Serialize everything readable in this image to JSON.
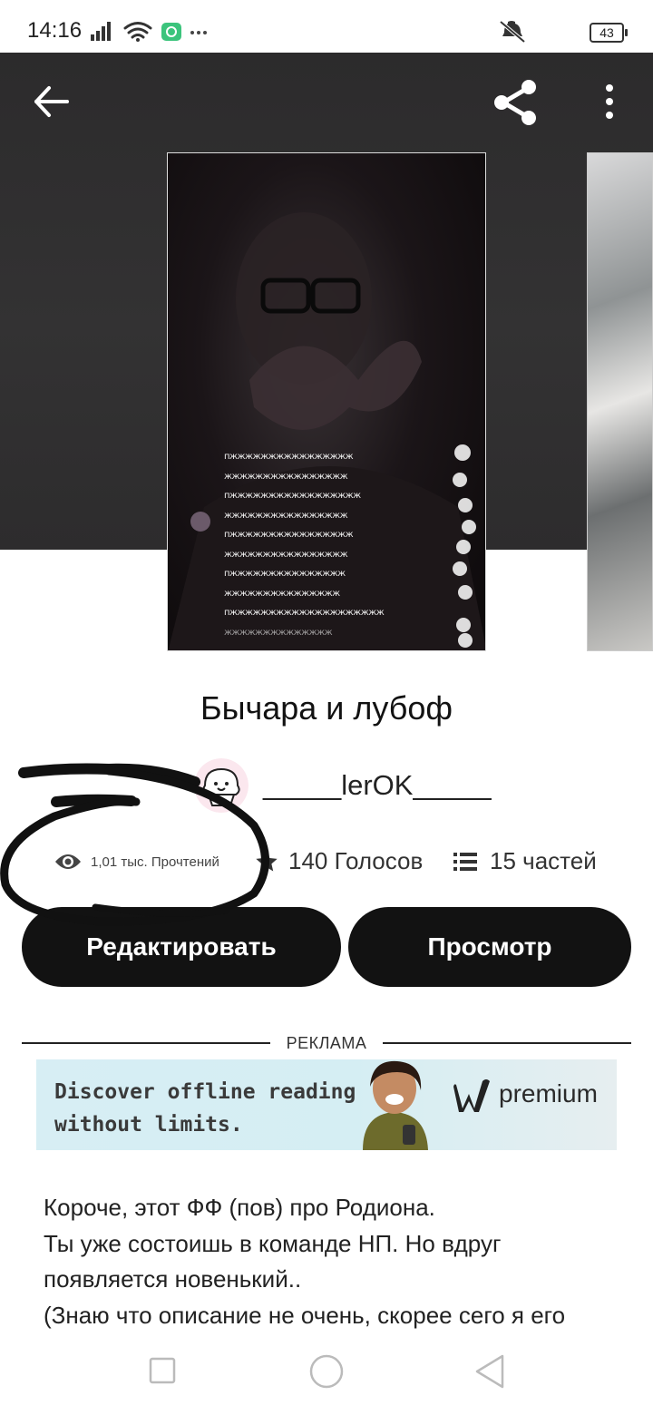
{
  "status_bar": {
    "time": "14:16",
    "battery": "43"
  },
  "toolbar": {
    "back_icon": "arrow-left-icon",
    "share_icon": "share-icon",
    "more_icon": "more-vertical-icon"
  },
  "story": {
    "title": "Бычара и лубоф",
    "author": "_____lerOK_____",
    "reads": "1,01 тыс. Прочтений",
    "votes": "140 Голосов",
    "parts": "15 частей",
    "cover_text": [
      "пжжжжжжжжжжжжжжжж",
      "жжжжжжжжжжжжжжжж",
      "пжжжжжжжжжжжжжжжжж",
      "жжжжжжжжжжжжжжжж",
      "пжжжжжжжжжжжжжжжж",
      "жжжжжжжжжжжжжжжж",
      "пжжжжжжжжжжжжжжж",
      "жжжжжжжжжжжжжжж",
      "пжжжжжжжжжжжжжжжжжжжж",
      "жжжжжжжжжжжжжж"
    ]
  },
  "actions": {
    "edit_label": "Редактировать",
    "view_label": "Просмотр"
  },
  "ad": {
    "label": "РЕКЛАМА",
    "line1": "Discover offline reading",
    "line2": "without limits.",
    "brand": "premium"
  },
  "description": {
    "lines": [
      "Короче, этот ФФ (пов) про Родиона.",
      "Ты уже состоишь в команде НП. Но вдруг",
      "появляется новенький..",
      "(Знаю что описание не очень, скорее сего я его"
    ]
  },
  "colors": {
    "hero_bg": "#2f2e2f",
    "button_bg": "#121212",
    "button_text": "#ffffff"
  }
}
